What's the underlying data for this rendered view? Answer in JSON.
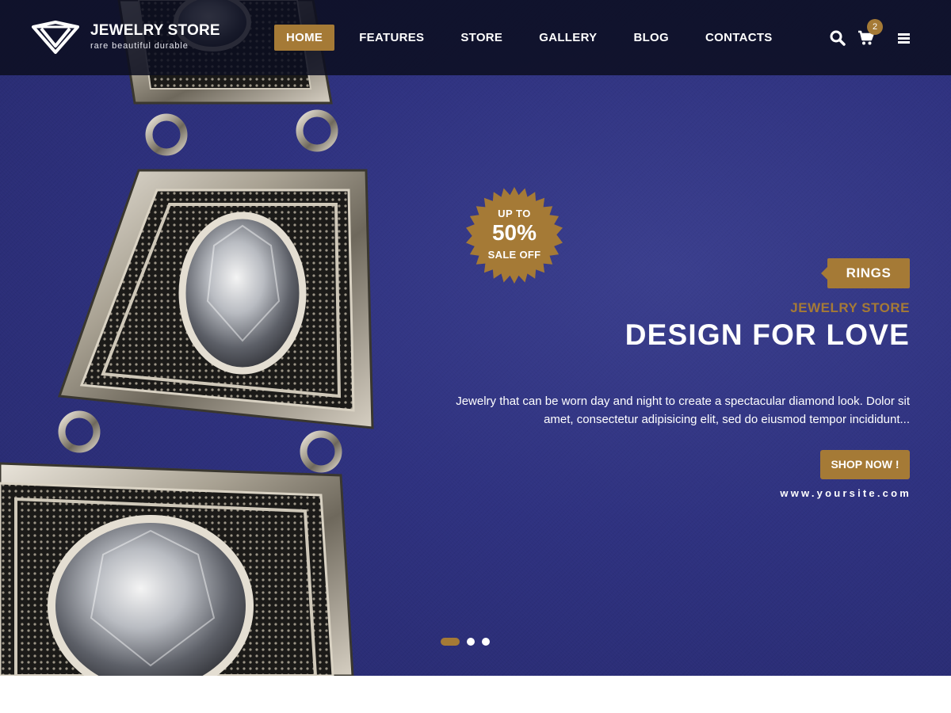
{
  "brand": {
    "name": "JEWELRY STORE",
    "tagline": "rare beautiful durable",
    "logo_icon": "diamond-logo-icon"
  },
  "nav": {
    "items": [
      {
        "label": "HOME",
        "active": true
      },
      {
        "label": "FEATURES",
        "active": false
      },
      {
        "label": "STORE",
        "active": false
      },
      {
        "label": "GALLERY",
        "active": false
      },
      {
        "label": "BLOG",
        "active": false
      },
      {
        "label": "CONTACTS",
        "active": false
      }
    ],
    "icons": {
      "search": "search-icon",
      "cart": "cart-icon",
      "menu": "menu-icon"
    },
    "cart_count": "2"
  },
  "hero": {
    "sale_badge": {
      "line1": "UP TO",
      "percent": "50%",
      "line3": "SALE OFF"
    },
    "category": "RINGS",
    "kicker": "JEWELRY STORE",
    "title": "DESIGN FOR LOVE",
    "description": "Jewelry that can be worn day and night to create a spectacular diamond look. Dolor sit amet, consectetur adipisicing elit, sed do eiusmod tempor incididunt...",
    "cta_label": "SHOP NOW !",
    "website": "www.yoursite.com"
  },
  "slider": {
    "slide_count": 3,
    "active_index": 0
  },
  "colors": {
    "accent": "#a57a36",
    "hero_background": "#2f3280",
    "header_background": "#0c0e20",
    "text_light": "#ffffff"
  }
}
